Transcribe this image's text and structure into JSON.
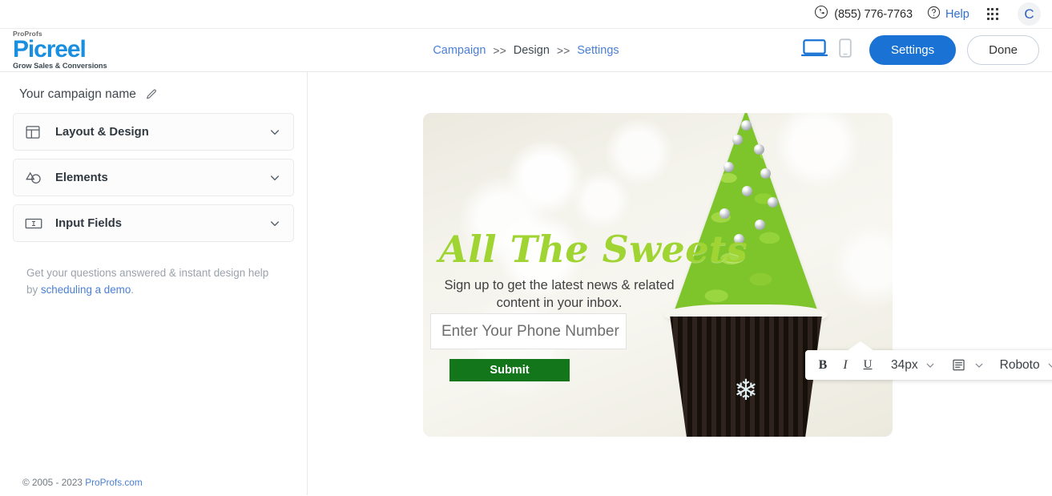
{
  "topbar": {
    "phone": "(855) 776-7763",
    "help_label": "Help",
    "phone_icon": "phone-in-circle-icon",
    "help_icon": "question-mark-circle-icon",
    "apps_icon": "grid-apps-icon",
    "avatar_initial": "C"
  },
  "header": {
    "logo": {
      "prefix": "ProProfs",
      "brand": "Picreel",
      "tagline": "Grow Sales & Conversions",
      "brand_color": "#1a8fe0"
    },
    "breadcrumb": {
      "items": [
        {
          "label": "Campaign",
          "active": false
        },
        {
          "label": "Design",
          "active": true
        },
        {
          "label": "Settings",
          "active": false
        }
      ],
      "separator": ">>"
    },
    "desktop_icon": "desktop-monitor-icon",
    "mobile_icon": "mobile-phone-icon",
    "settings_label": "Settings",
    "done_label": "Done",
    "primary_color": "#1a73d4"
  },
  "sidebar": {
    "campaign_name": "Your campaign name",
    "edit_icon": "pencil-edit-icon",
    "sections": [
      {
        "label": "Layout & Design",
        "icon": "layout-grid-icon",
        "chevron": "chevron-down-icon"
      },
      {
        "label": "Elements",
        "icon": "shapes-icon",
        "chevron": "chevron-down-icon"
      },
      {
        "label": "Input Fields",
        "icon": "input-field-icon",
        "chevron": "chevron-down-icon"
      }
    ],
    "help_note_text": "Get your questions answered & instant design help by ",
    "help_note_link": "scheduling a demo",
    "help_note_period": ".",
    "footer_copy": "© 2005 - 2023 ",
    "footer_link": "ProProfs.com"
  },
  "popup": {
    "headline": "All The Sweets",
    "headline_color": "#9fd432",
    "subtext": "Sign up to get the latest news & related content in your inbox.",
    "input_value": "Enter Your Phone Number",
    "submit_label": "Submit",
    "submit_color": "#14761b"
  },
  "toolbar": {
    "bold": "B",
    "italic": "I",
    "underline": "U",
    "font_size": "34px",
    "align_icon": "text-align-icon",
    "font_family": "Roboto",
    "text_color_icon": "text-color-a-icon",
    "bg_color_icon": "background-color-a-icon",
    "image_icon": "insert-image-icon",
    "border_icon": "border-corners-icon",
    "reset_icon": "reset-revert-icon",
    "delete_icon": "trash-delete-icon",
    "chevron_icon": "chevron-down-icon"
  }
}
